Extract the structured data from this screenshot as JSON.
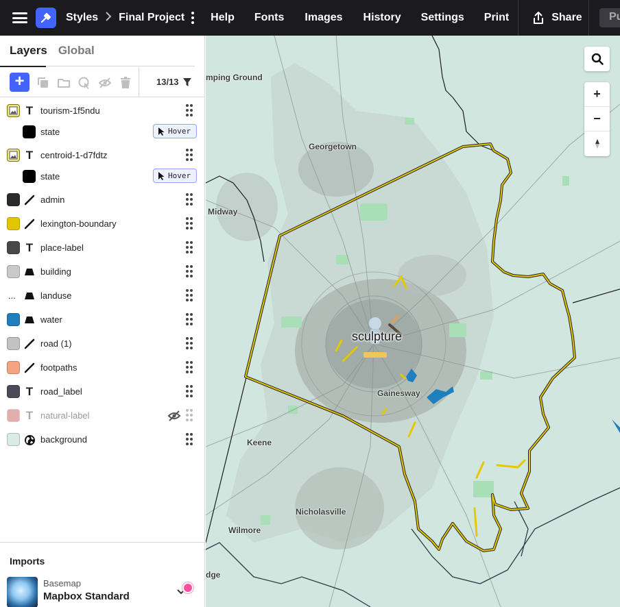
{
  "topbar": {
    "breadcrumb_root": "Styles",
    "breadcrumb_current": "Final Project",
    "nav": [
      "Help",
      "Fonts",
      "Images",
      "History",
      "Settings",
      "Print"
    ],
    "share_label": "Share",
    "publish_label": "Pu"
  },
  "panel": {
    "tabs": [
      "Layers",
      "Global"
    ],
    "layer_count": "13/13",
    "layers": [
      {
        "name": "tourism-1f5ndu",
        "type": "symbol-icon",
        "swatch": "#e5d200",
        "sub": {
          "name": "state",
          "swatch": "#000000",
          "chip": "Hover"
        }
      },
      {
        "name": "centroid-1-d7fdtz",
        "type": "symbol-icon",
        "swatch": "#e5d200",
        "sub": {
          "name": "state",
          "swatch": "#000000",
          "chip": "Hover"
        }
      },
      {
        "name": "admin",
        "type": "line",
        "swatch": "#2b2b2b"
      },
      {
        "name": "lexington-boundary",
        "type": "line",
        "swatch": "#e2c700"
      },
      {
        "name": "place-label",
        "type": "symbol",
        "swatch": "#484848"
      },
      {
        "name": "building",
        "type": "fill",
        "swatch": "#c9c9c9"
      },
      {
        "name": "landuse",
        "type": "fill",
        "swatch_text": "..."
      },
      {
        "name": "water",
        "type": "fill",
        "swatch": "#1e7fbf"
      },
      {
        "name": "road (1)",
        "type": "line",
        "swatch": "#c2c2c2"
      },
      {
        "name": "footpaths",
        "type": "line",
        "swatch": "#f5a483"
      },
      {
        "name": "road_label",
        "type": "symbol",
        "swatch": "#4a4a58"
      },
      {
        "name": "natural-label",
        "type": "symbol",
        "swatch": "#e3adad",
        "hidden": true
      },
      {
        "name": "background",
        "type": "background",
        "swatch": "#d9ebe4"
      }
    ],
    "imports": {
      "title": "Imports",
      "basemap_kicker": "Basemap",
      "basemap_name": "Mapbox Standard"
    }
  },
  "map": {
    "places": [
      "mping Ground",
      "Georgetown",
      "Midway",
      "Gainesway",
      "Keene",
      "Nicholasville",
      "Wilmore",
      "dge"
    ],
    "poi_label": "sculpture",
    "colors": {
      "background": "#d1e6df",
      "boundary": "#e5c800",
      "urban": "#b2bab6",
      "park": "#a9dfb6",
      "water": "#1e7fbf"
    }
  }
}
